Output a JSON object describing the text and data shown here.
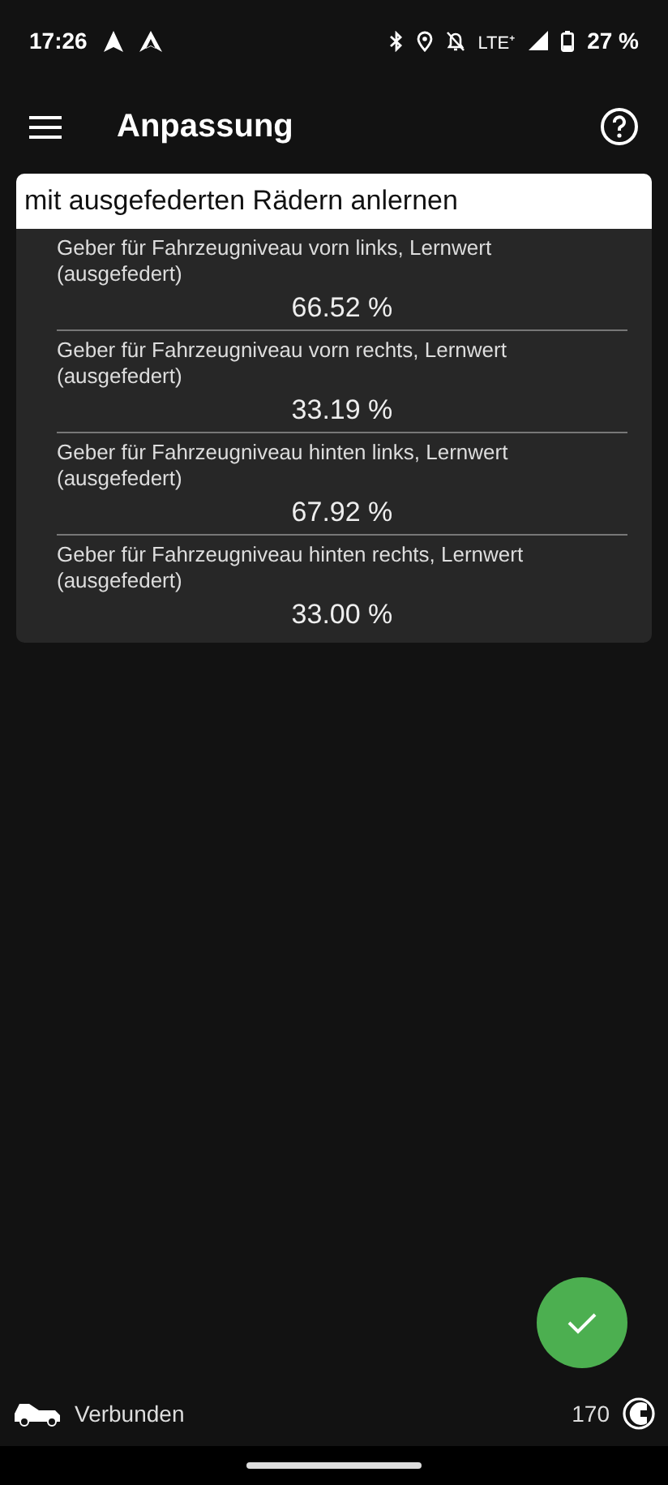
{
  "status_bar": {
    "time": "17:26",
    "lte": "LTE⁺",
    "battery": "27 %"
  },
  "toolbar": {
    "title": "Anpassung"
  },
  "card": {
    "header": "mit ausgefederten Rädern anlernen",
    "rows": [
      {
        "label": "Geber für Fahrzeugniveau vorn links, Lernwert (ausgefedert)",
        "value": "66.52 %"
      },
      {
        "label": "Geber für Fahrzeugniveau vorn rechts, Lernwert (ausgefedert)",
        "value": "33.19 %"
      },
      {
        "label": "Geber für Fahrzeugniveau hinten links, Lernwert (ausgefedert)",
        "value": "67.92 %"
      },
      {
        "label": "Geber für Fahrzeugniveau hinten rechts, Lernwert (ausgefedert)",
        "value": "33.00 %"
      }
    ]
  },
  "footer": {
    "status": "Verbunden",
    "count": "170"
  }
}
